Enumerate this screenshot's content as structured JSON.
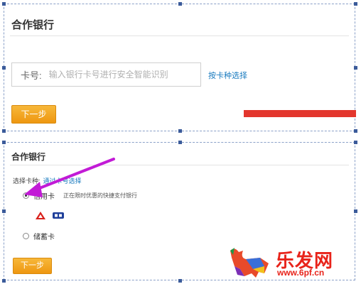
{
  "panel_top": {
    "title": "合作银行",
    "card_label": "卡号:",
    "card_placeholder": "输入银行卡号进行安全智能识别",
    "by_type_link": "按卡种选择",
    "next_button": "下一步"
  },
  "panel_bottom": {
    "title": "合作银行",
    "card_type_label": "选择卡种:",
    "card_type_link": "通过卡号选择",
    "options": [
      {
        "label": "信用卡",
        "hint": "正在限时优惠的快捷支付银行",
        "checked": true
      },
      {
        "label": "储蓄卡",
        "checked": false
      }
    ],
    "next_button": "下一步"
  },
  "watermark": {
    "brand": "乐发网",
    "url": "www.6pf.cn"
  },
  "colors": {
    "button": "#f0a020",
    "link": "#1a7bbf",
    "red_bar": "#e3362d",
    "arrow": "#c21bd6"
  },
  "icons": [
    "bank-logo-red-icon",
    "bank-logo-blue-icon",
    "pointer-arrow-icon",
    "bull-logo-icon"
  ]
}
